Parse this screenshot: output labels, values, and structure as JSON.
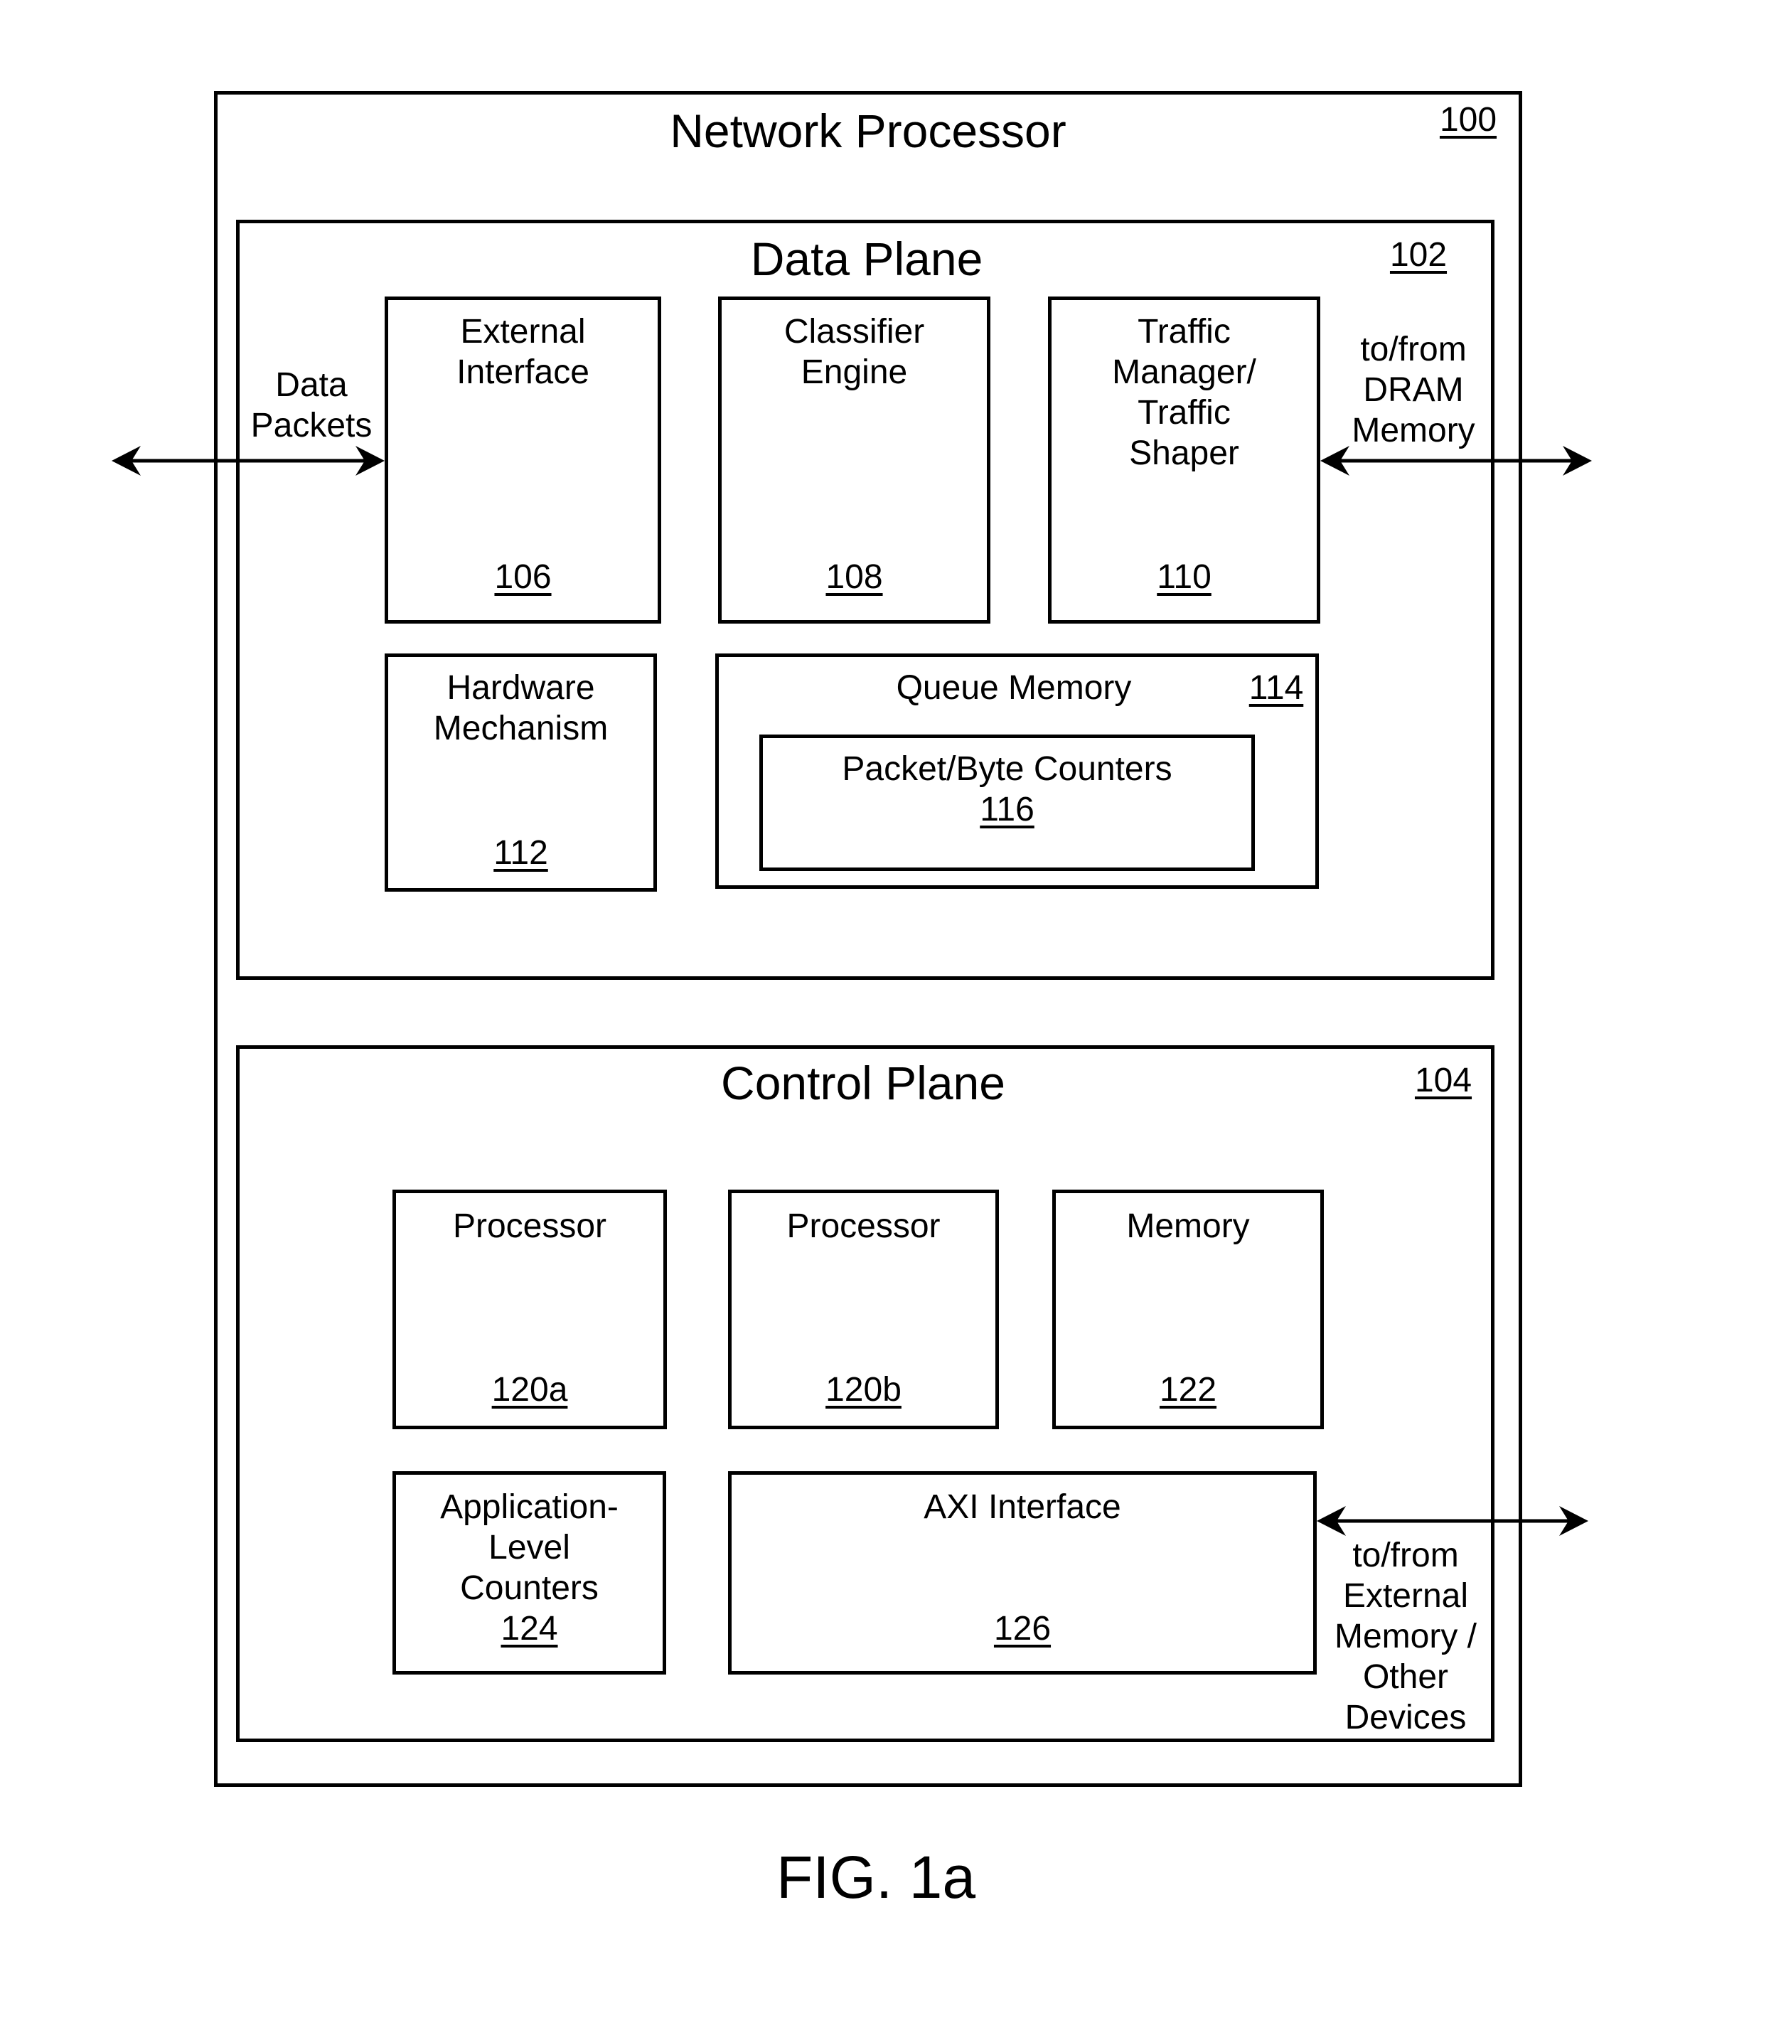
{
  "figure": {
    "caption": "FIG. 1a",
    "network_processor": {
      "title": "Network Processor",
      "ref": "100"
    },
    "data_plane": {
      "title": "Data Plane",
      "ref": "102",
      "blocks": {
        "external_interface": {
          "label": "External\nInterface",
          "ref": "106"
        },
        "classifier_engine": {
          "label": "Classifier\nEngine",
          "ref": "108"
        },
        "traffic_manager": {
          "label": "Traffic\nManager/\nTraffic\nShaper",
          "ref": "110"
        },
        "hardware_mechanism": {
          "label": "Hardware\nMechanism",
          "ref": "112"
        },
        "queue_memory": {
          "label": "Queue Memory",
          "ref": "114"
        },
        "packet_byte_counters": {
          "label": "Packet/Byte Counters",
          "ref": "116"
        }
      },
      "left_io_label": "Data\nPackets",
      "right_io_label": "to/from\nDRAM\nMemory"
    },
    "control_plane": {
      "title": "Control Plane",
      "ref": "104",
      "blocks": {
        "processor_a": {
          "label": "Processor",
          "ref": "120a"
        },
        "processor_b": {
          "label": "Processor",
          "ref": "120b"
        },
        "memory": {
          "label": "Memory",
          "ref": "122"
        },
        "app_counters": {
          "label": "Application-\nLevel\nCounters",
          "ref": "124"
        },
        "axi_interface": {
          "label": "AXI Interface",
          "ref": "126"
        }
      },
      "right_io_label": "to/from\nExternal\nMemory /\nOther\nDevices"
    }
  }
}
